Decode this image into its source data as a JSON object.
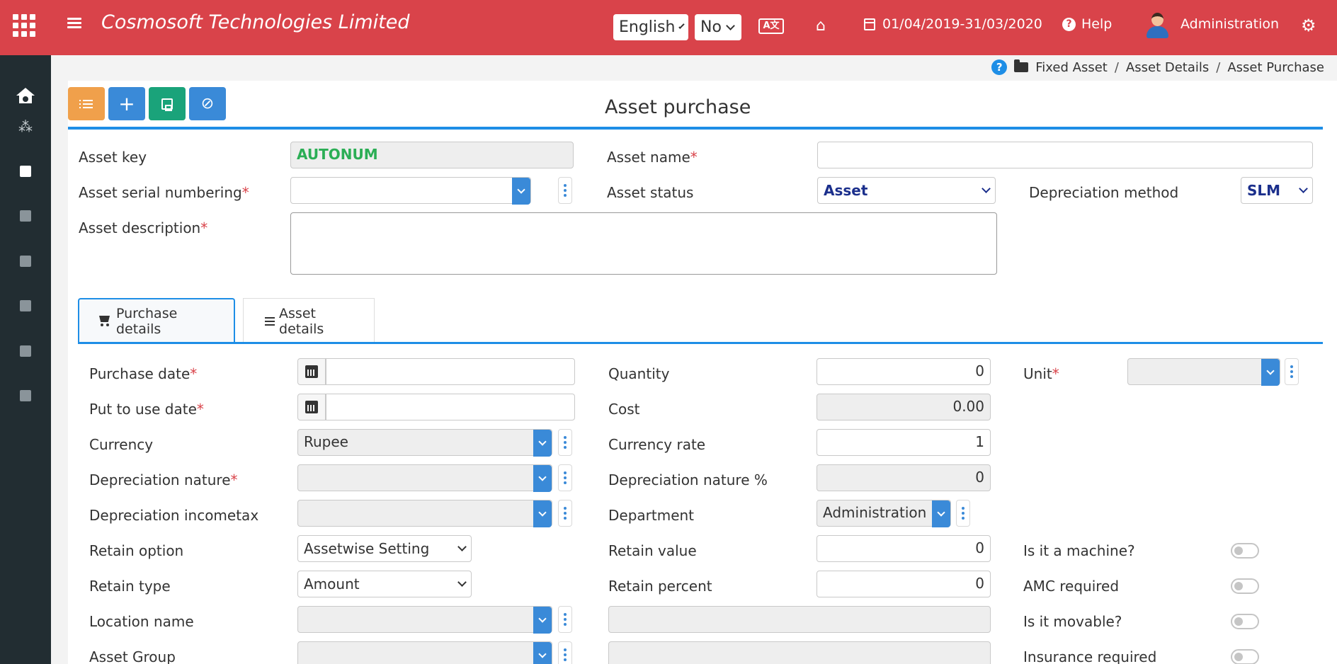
{
  "header": {
    "company": "Cosmosoft Technologies Limited",
    "language": "English",
    "no_select": "No",
    "translate_icon": "translate-icon",
    "financial_year": "01/04/2019-31/03/2020",
    "help": "Help",
    "user": "Administration"
  },
  "sidebar": {
    "items": [
      "home-icon",
      "cubes-icon",
      "module-1",
      "module-2",
      "module-3",
      "module-4",
      "module-5",
      "module-6"
    ]
  },
  "breadcrumb": {
    "items": [
      "Fixed Asset",
      "Asset Details",
      "Asset Purchase"
    ],
    "separator": "/"
  },
  "page": {
    "title": "Asset purchase"
  },
  "form": {
    "asset_key_label": "Asset key",
    "asset_key_value": "AUTONUM",
    "asset_name_label": "Asset name",
    "asset_name_value": "",
    "serial_numbering_label": "Asset serial numbering",
    "serial_numbering_value": "",
    "asset_status_label": "Asset status",
    "asset_status_value": "Asset",
    "depreciation_method_label": "Depreciation method",
    "depreciation_method_value": "SLM",
    "description_label": "Asset description",
    "description_value": "",
    "required_mark": "*"
  },
  "tabs": [
    {
      "label": "Purchase details",
      "active": true
    },
    {
      "label": "Asset details",
      "active": false
    }
  ],
  "purchase": {
    "purchase_date_label": "Purchase date",
    "put_to_use_label": "Put to use date",
    "currency_label": "Currency",
    "currency_value": "Rupee",
    "dep_nature_label": "Depreciation nature",
    "dep_incometax_label": "Depreciation incometax",
    "retain_option_label": "Retain option",
    "retain_option_value": "Assetwise Setting",
    "retain_type_label": "Retain type",
    "retain_type_value": "Amount",
    "location_label": "Location name",
    "asset_group_label": "Asset Group",
    "quantity_label": "Quantity",
    "quantity_value": "0",
    "cost_label": "Cost",
    "cost_value": "0.00",
    "currency_rate_label": "Currency rate",
    "currency_rate_value": "1",
    "dep_nature_pct_label": "Depreciation nature %",
    "dep_nature_pct_value": "0",
    "department_label": "Department",
    "department_value": "Administration",
    "retain_value_label": "Retain value",
    "retain_value_value": "0",
    "retain_percent_label": "Retain percent",
    "retain_percent_value": "0",
    "unit_label": "Unit",
    "is_machine_label": "Is it a machine?",
    "amc_required_label": "AMC required",
    "is_movable_label": "Is it movable?",
    "insurance_required_label": "Insurance required",
    "is_machine_on": false,
    "amc_required_on": false,
    "is_movable_on": false,
    "insurance_required_on": false
  },
  "colors": {
    "header_bg": "#d9434a",
    "sidebar_bg": "#222d32",
    "accent_blue": "#1e8ee6",
    "list_button": "#f0a04b",
    "save_button": "#1aa37a",
    "autonum_text": "#2bae55",
    "required": "#d9434a"
  }
}
